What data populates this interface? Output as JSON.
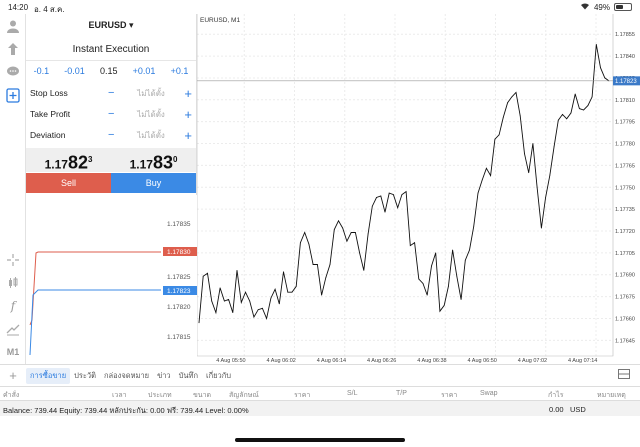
{
  "status": {
    "time": "14:20",
    "date": "อ. 4 ส.ค.",
    "battery": "49%",
    "battery_level": 0.49
  },
  "toolbar": {
    "icons": [
      "user-icon",
      "trade-icon",
      "chat-icon",
      "new-order-icon",
      "crosshair-icon",
      "candles-icon",
      "indicator-icon",
      "objects-icon",
      "timeframe-icon"
    ],
    "timeframe": "M1",
    "f_label": "f"
  },
  "order": {
    "symbol": "EURUSD",
    "execution": "Instant Execution",
    "steps": [
      "-0.1",
      "-0.01",
      "0.15",
      "+0.01",
      "+0.1"
    ],
    "stop_loss": {
      "label": "Stop Loss",
      "value": "ไม่ได้ตั้ง"
    },
    "take_profit": {
      "label": "Take Profit",
      "value": "ไม่ได้ตั้ง"
    },
    "deviation": {
      "label": "Deviation",
      "value": "ไม่ได้ตั้ง"
    },
    "sell_price": {
      "small": "1.17",
      "big": "82",
      "sup": "3"
    },
    "buy_price": {
      "small": "1.17",
      "big": "83",
      "sup": "0"
    },
    "sell_label": "Sell",
    "buy_label": "Buy"
  },
  "mini_chart": {
    "ticks": [
      "1.17835",
      "1.17830",
      "1.17825",
      "1.17823",
      "1.17820",
      "1.17815"
    ],
    "ask": "1.17830",
    "bid": "1.17823",
    "ask_color": "#de5e4d",
    "bid_color": "#3b8ae5"
  },
  "chart": {
    "title": "EURUSD, M1",
    "current_price": "1.17823",
    "x_ticks": [
      "4 Aug 05:50",
      "4 Aug 06:02",
      "4 Aug 06:14",
      "4 Aug 06:26",
      "4 Aug 06:38",
      "4 Aug 06:50",
      "4 Aug 07:02",
      "4 Aug 07:14"
    ],
    "y_ticks": [
      "1.17855",
      "1.17840",
      "1.17825",
      "1.17810",
      "1.17795",
      "1.17780",
      "1.17765",
      "1.17750",
      "1.17735",
      "1.17720",
      "1.17705",
      "1.17690",
      "1.17675",
      "1.17660",
      "1.17645"
    ]
  },
  "chart_data": {
    "type": "line",
    "title": "EURUSD, M1",
    "x_ticks": [
      "4 Aug 05:50",
      "4 Aug 06:02",
      "4 Aug 06:14",
      "4 Aug 06:26",
      "4 Aug 06:38",
      "4 Aug 06:50",
      "4 Aug 07:02",
      "4 Aug 07:14"
    ],
    "ylim": [
      1.17637,
      1.17862
    ],
    "values": [
      1.17657,
      1.17689,
      1.17691,
      1.17672,
      1.17664,
      1.17681,
      1.17672,
      1.17673,
      1.17664,
      1.17693,
      1.17671,
      1.17678,
      1.17672,
      1.17661,
      1.17666,
      1.17667,
      1.1766,
      1.17674,
      1.1768,
      1.1767,
      1.17692,
      1.17678,
      1.17678,
      1.17682,
      1.17712,
      1.17719,
      1.17711,
      1.17697,
      1.17697,
      1.17676,
      1.17688,
      1.17697,
      1.17721,
      1.17727,
      1.17722,
      1.17713,
      1.17719,
      1.17719,
      1.17705,
      1.17693,
      1.17718,
      1.17737,
      1.17743,
      1.17744,
      1.17733,
      1.17746,
      1.17745,
      1.17736,
      1.17745,
      1.17747,
      1.1771,
      1.17712,
      1.17687,
      1.17684,
      1.17676,
      1.17696,
      1.17705,
      1.17665,
      1.17669,
      1.17682,
      1.17707,
      1.17689,
      1.17673,
      1.177,
      1.17707,
      1.17723,
      1.17746,
      1.17755,
      1.17763,
      1.17758,
      1.17783,
      1.17786,
      1.17798,
      1.17808,
      1.17812,
      1.17815,
      1.17799,
      1.17773,
      1.1776,
      1.1778,
      1.1775,
      1.17722,
      1.17743,
      1.17758,
      1.17778,
      1.17796,
      1.178,
      1.17797,
      1.17801,
      1.17814,
      1.17804,
      1.17803,
      1.17806,
      1.17812,
      1.17848,
      1.17832,
      1.17825,
      1.17823
    ]
  },
  "tabs": {
    "items": [
      "การซื้อขาย",
      "ประวัติ",
      "กล่องจดหมาย",
      "ข่าว",
      "บันทึก",
      "เกี่ยวกับ"
    ],
    "active_index": 0
  },
  "columns": [
    "คำสั่ง",
    "เวลา",
    "ประเภท",
    "ขนาด",
    "สัญลักษณ์",
    "ราคา",
    "S/L",
    "T/P",
    "ราคา",
    "Swap",
    "กำไร",
    "หมายเหตุ"
  ],
  "balance": {
    "text": "Balance: 739.44 Equity: 739.44 หลักประกัน: 0.00 ฟรี: 739.44 Level: 0.00%",
    "amount": "0.00",
    "currency": "USD"
  },
  "colors": {
    "accent": "#2b7bdf",
    "sell": "#de5e4d",
    "buy": "#3b8ae5",
    "price_label": "#3b7ac8"
  }
}
